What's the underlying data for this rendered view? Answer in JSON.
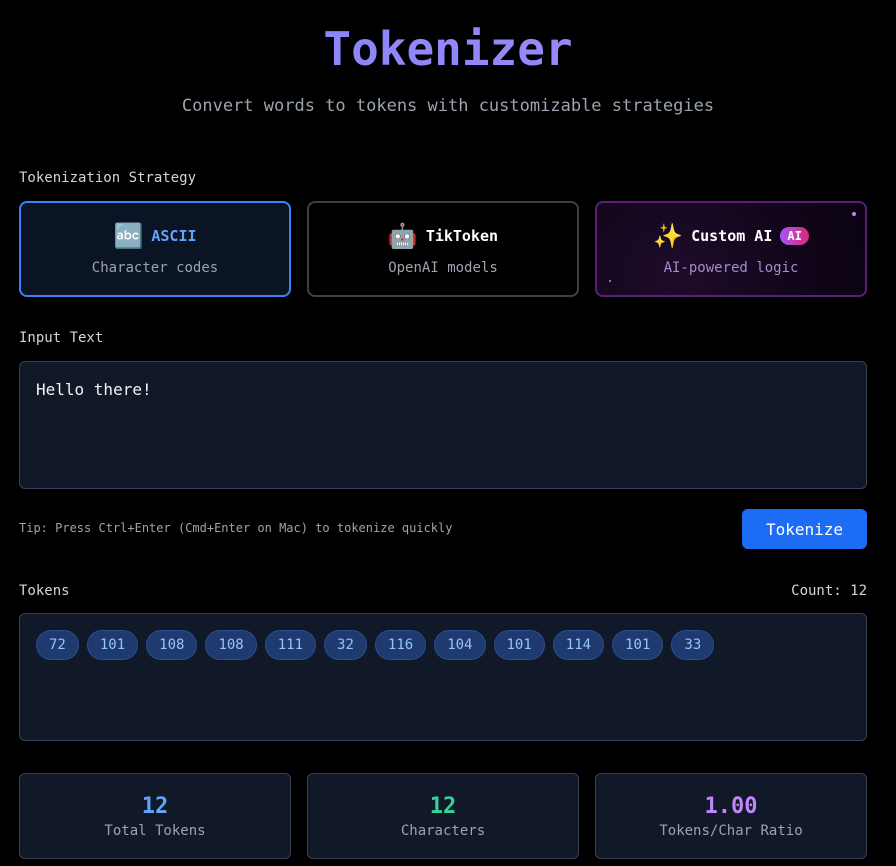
{
  "header": {
    "title": "Tokenizer",
    "subtitle": "Convert words to tokens with customizable strategies"
  },
  "strategy": {
    "label": "Tokenization Strategy",
    "options": [
      {
        "icon": "abc-icon",
        "glyph": "🔤",
        "name": "ASCII",
        "description": "Character codes",
        "selected": true
      },
      {
        "icon": "robot-icon",
        "glyph": "🤖",
        "name": "TikToken",
        "description": "OpenAI models",
        "selected": false
      },
      {
        "icon": "sparkles-icon",
        "glyph": "✨",
        "name": "Custom AI",
        "badge": "AI",
        "description": "AI-powered logic",
        "selected": false
      }
    ]
  },
  "input": {
    "label": "Input Text",
    "value": "Hello there!"
  },
  "tip": "Tip: Press Ctrl+Enter (Cmd+Enter on Mac) to tokenize quickly",
  "tokenize_button": "Tokenize",
  "tokens": {
    "label": "Tokens",
    "count_text": "Count: 12",
    "values": [
      "72",
      "101",
      "108",
      "108",
      "111",
      "32",
      "116",
      "104",
      "101",
      "114",
      "101",
      "33"
    ]
  },
  "stats": [
    {
      "value": "12",
      "label": "Total Tokens",
      "color": "#60a5fa"
    },
    {
      "value": "12",
      "label": "Characters",
      "color": "#34d399"
    },
    {
      "value": "1.00",
      "label": "Tokens/Char Ratio",
      "color": "#c084fc"
    }
  ],
  "colors": {
    "accent": "#1d6cf5",
    "selected_border": "#3b82f6"
  }
}
